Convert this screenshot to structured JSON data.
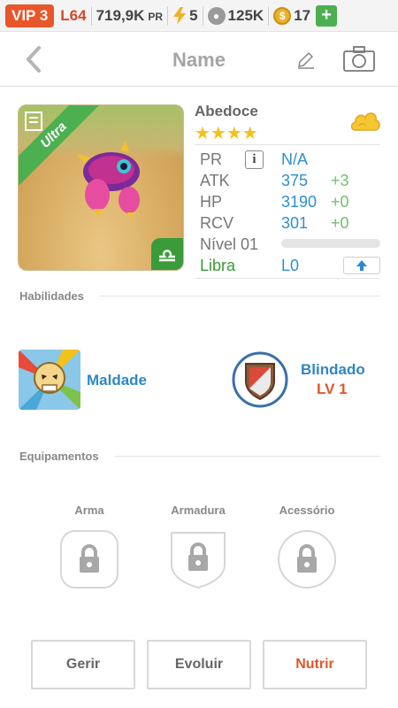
{
  "topbar": {
    "vip_label": "VIP 3",
    "level": "L64",
    "power_value": "719,9K",
    "power_unit": "PR",
    "energy": "5",
    "food": "125K",
    "coins": "17",
    "add_label": "+"
  },
  "header": {
    "title": "Name"
  },
  "monster": {
    "name": "Abedoce",
    "rarity": "Ultra",
    "stars": "★★★★",
    "stats": [
      {
        "label": "PR",
        "value": "N/A",
        "bonus": ""
      },
      {
        "label": "ATK",
        "value": "375",
        "bonus": "+3"
      },
      {
        "label": "HP",
        "value": "3190",
        "bonus": "+0"
      },
      {
        "label": "RCV",
        "value": "301",
        "bonus": "+0"
      }
    ],
    "level_label": "Nível 01",
    "level_progress": 0,
    "sign": "Libra",
    "sign_level": "L0"
  },
  "abilities": {
    "section_title": "Habilidades",
    "items": [
      {
        "name": "Maldade",
        "level": ""
      },
      {
        "name": "Blindado",
        "level": "LV 1"
      }
    ]
  },
  "equipment": {
    "section_title": "Equipamentos",
    "slots": [
      {
        "label": "Arma",
        "icon": "lock-icon"
      },
      {
        "label": "Armadura",
        "icon": "lock-icon"
      },
      {
        "label": "Acessório",
        "icon": "lock-icon"
      }
    ]
  },
  "actions": {
    "manage": "Gerir",
    "evolve": "Evoluir",
    "feed": "Nutrir"
  },
  "colors": {
    "vip": "#e8562a",
    "accent_blue": "#2f87c4",
    "accent_red": "#e0572a",
    "green": "#4caf50"
  }
}
